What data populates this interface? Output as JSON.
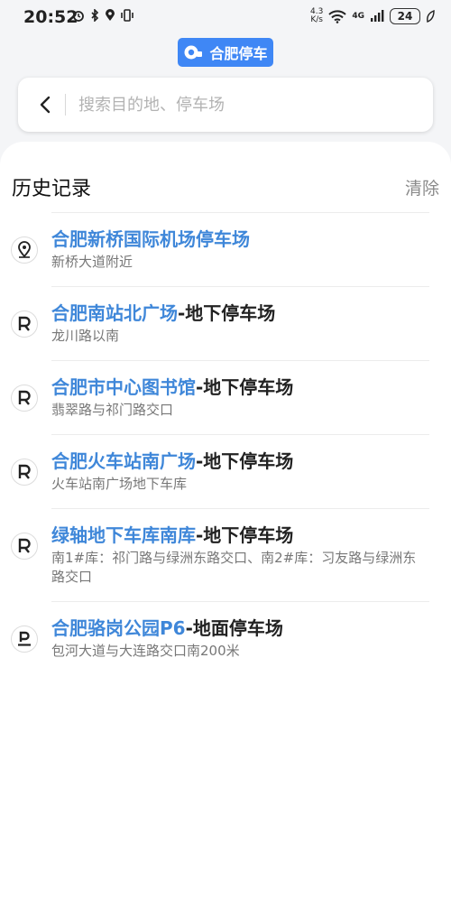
{
  "status_bar": {
    "time": "20:52",
    "net_speed_value": "4.3",
    "net_speed_unit": "K/s",
    "net_type": "4G",
    "battery": "24"
  },
  "brand": {
    "label": "合肥停车"
  },
  "search": {
    "placeholder": "搜索目的地、停车场"
  },
  "history": {
    "title": "历史记录",
    "clear_label": "清除",
    "items": [
      {
        "icon": "location-pin-icon",
        "title_highlight": "合肥新桥国际机场停车场",
        "title_rest": "",
        "subtitle": "新桥大道附近"
      },
      {
        "icon": "parking-r-icon",
        "title_highlight": "合肥南站北广场",
        "title_rest": "-地下停车场",
        "subtitle": "龙川路以南"
      },
      {
        "icon": "parking-r-icon",
        "title_highlight": "合肥市中心图书馆",
        "title_rest": "-地下停车场",
        "subtitle": "翡翠路与祁门路交口"
      },
      {
        "icon": "parking-r-icon",
        "title_highlight": "合肥火车站南广场",
        "title_rest": "-地下停车场",
        "subtitle": "火车站南广场地下车库"
      },
      {
        "icon": "parking-r-icon",
        "title_highlight": "绿轴地下车库南库",
        "title_rest": "-地下停车场",
        "subtitle": "南1#库：祁门路与绿洲东路交口、南2#库：习友路与绿洲东路交口"
      },
      {
        "icon": "parking-p-icon",
        "title_highlight": "合肥骆岗公园P6",
        "title_rest": "-地面停车场",
        "subtitle": "包河大道与大连路交口南200米"
      }
    ]
  },
  "colors": {
    "accent": "#3f87f5",
    "link": "#3f87d9"
  }
}
